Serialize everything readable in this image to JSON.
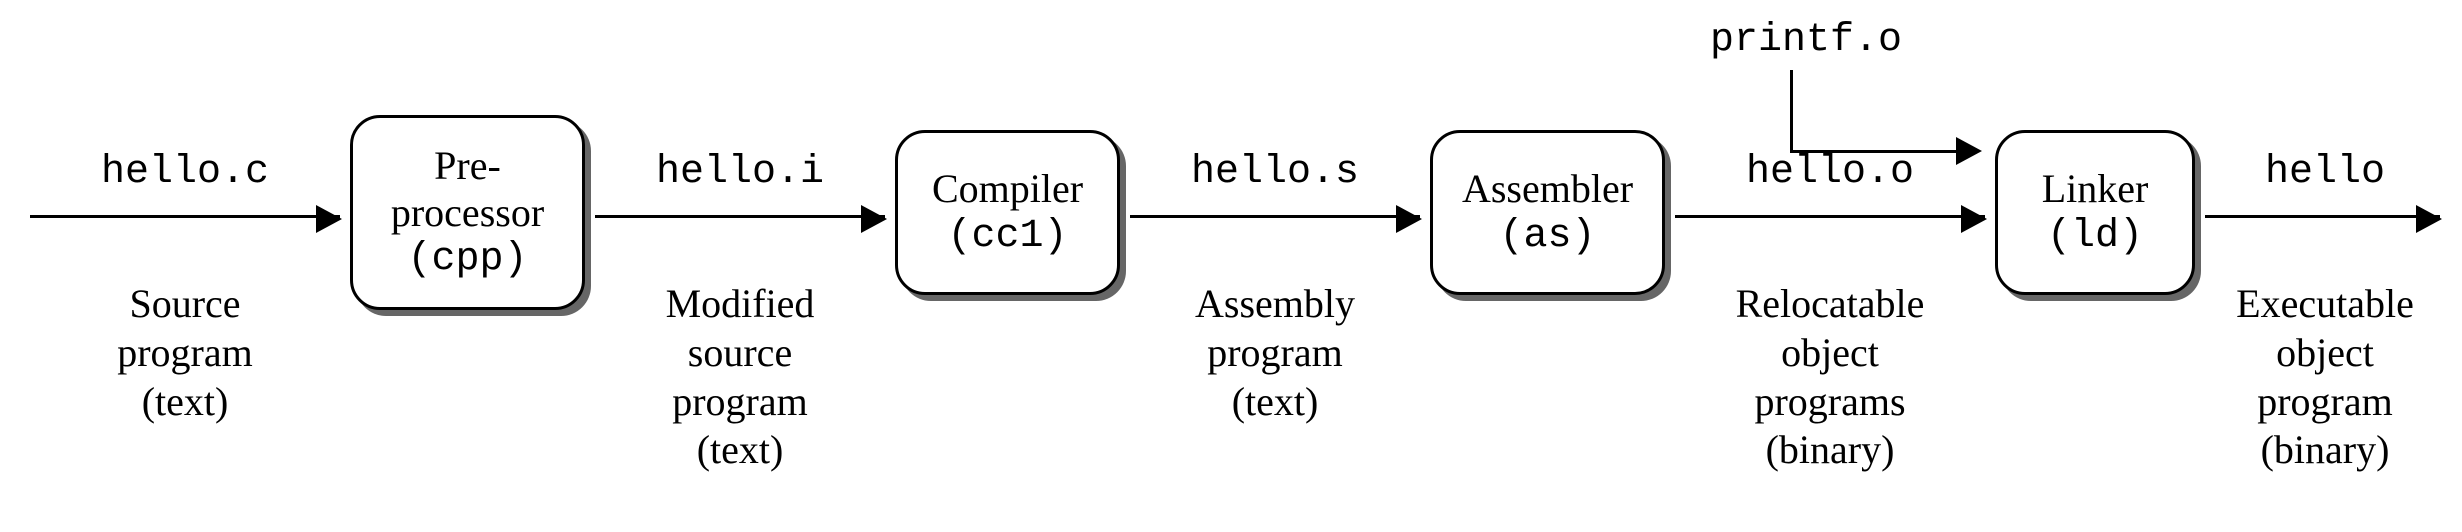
{
  "stages": [
    {
      "title_line1": "Pre-",
      "title_line2": "processor",
      "tool": "(cpp)"
    },
    {
      "title_line1": "Compiler",
      "title_line2": "",
      "tool": "(cc1)"
    },
    {
      "title_line1": "Assembler",
      "title_line2": "",
      "tool": "(as)"
    },
    {
      "title_line1": "Linker",
      "title_line2": "",
      "tool": "(ld)"
    }
  ],
  "edges": [
    {
      "file": "hello.c",
      "desc_l1": "Source",
      "desc_l2": "program",
      "desc_l3": "(text)",
      "desc_l4": ""
    },
    {
      "file": "hello.i",
      "desc_l1": "Modified",
      "desc_l2": "source",
      "desc_l3": "program",
      "desc_l4": "(text)"
    },
    {
      "file": "hello.s",
      "desc_l1": "Assembly",
      "desc_l2": "program",
      "desc_l3": "(text)",
      "desc_l4": ""
    },
    {
      "file": "hello.o",
      "desc_l1": "Relocatable",
      "desc_l2": "object",
      "desc_l3": "programs",
      "desc_l4": "(binary)"
    },
    {
      "file": "hello",
      "desc_l1": "Executable",
      "desc_l2": "object",
      "desc_l3": "program",
      "desc_l4": "(binary)"
    }
  ],
  "external_input": "printf.o"
}
